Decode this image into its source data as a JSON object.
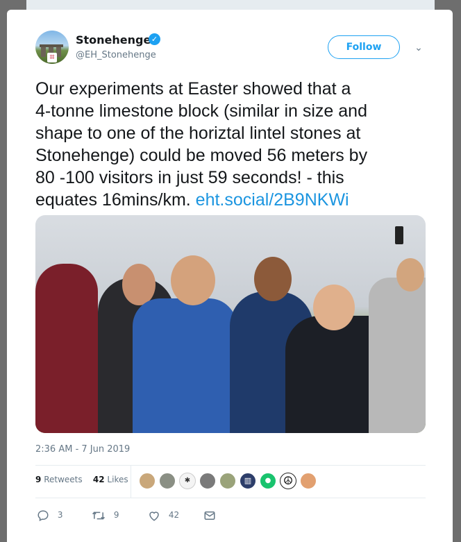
{
  "author": {
    "display_name": "Stonehenge",
    "handle": "@EH_Stonehenge",
    "avatar_badge": "⌗"
  },
  "follow_label": "Follow",
  "tweet": {
    "lines": [
      "Our experiments at Easter showed that a",
      "4-tonne limestone block (similar in size and",
      "shape to one of the horiztal lintel stones at",
      "Stonehenge) could be moved 56 meters by",
      "80 -100 visitors in just 59 seconds! -  this",
      "equates 16mins/km."
    ],
    "link": "eht.social/2B9NKWi"
  },
  "timestamp": "2:36 AM - 7 Jun 2019",
  "stats": {
    "retweets_count": "9",
    "retweets_label": "Retweets",
    "likes_count": "42",
    "likes_label": "Likes"
  },
  "liker_avatars": [
    {
      "icon": "person-hat-icon",
      "color": "#c9a77a"
    },
    {
      "icon": "person-icon",
      "color": "#8a8f84"
    },
    {
      "icon": "crest-icon",
      "color": "#f4f4f4"
    },
    {
      "icon": "person-bw-icon",
      "color": "#7a7a7a"
    },
    {
      "icon": "animal-icon",
      "color": "#9aa37a"
    },
    {
      "icon": "building-icon",
      "color": "#2d3e6a"
    },
    {
      "icon": "logo-green-icon",
      "color": "#19c36e"
    },
    {
      "icon": "peace-icon",
      "color": "#ffffff"
    },
    {
      "icon": "person-blonde-icon",
      "color": "#e2a070"
    }
  ],
  "actions": {
    "reply_count": "3",
    "retweet_count": "9",
    "like_count": "42"
  },
  "colors": {
    "accent": "#1da1f2",
    "link": "#1b95e0",
    "secondary_text": "#657786",
    "primary_text": "#14171a"
  }
}
